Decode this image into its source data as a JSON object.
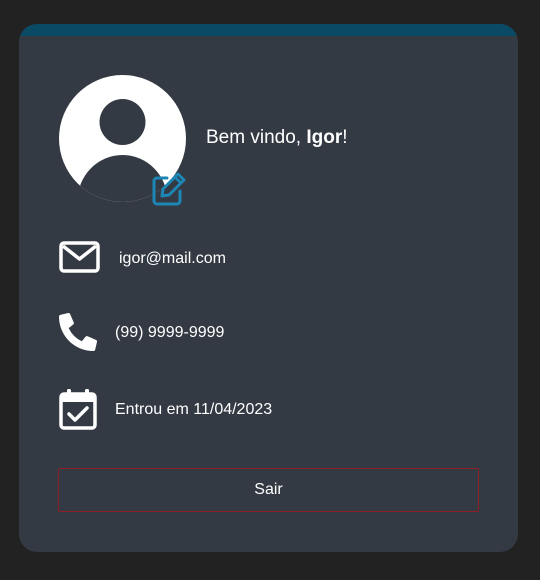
{
  "colors": {
    "page_background": "#222222",
    "card_background": "#343a43",
    "card_accent": "#0b4a64",
    "edit_icon": "#1c86b5",
    "logout_border": "#8e1f24",
    "text": "#ffffff"
  },
  "profile": {
    "avatar_icon": "user-circle-icon",
    "edit_icon": "edit-icon",
    "greeting_prefix": "Bem vindo, ",
    "user_name": "Igor",
    "greeting_suffix": "!"
  },
  "info": {
    "email": {
      "icon": "envelope-icon",
      "value": "igor@mail.com"
    },
    "phone": {
      "icon": "phone-icon",
      "value": "(99) 9999-9999"
    },
    "joined": {
      "icon": "calendar-check-icon",
      "value": "Entrou em 11/04/2023"
    }
  },
  "actions": {
    "logout_label": "Sair"
  }
}
